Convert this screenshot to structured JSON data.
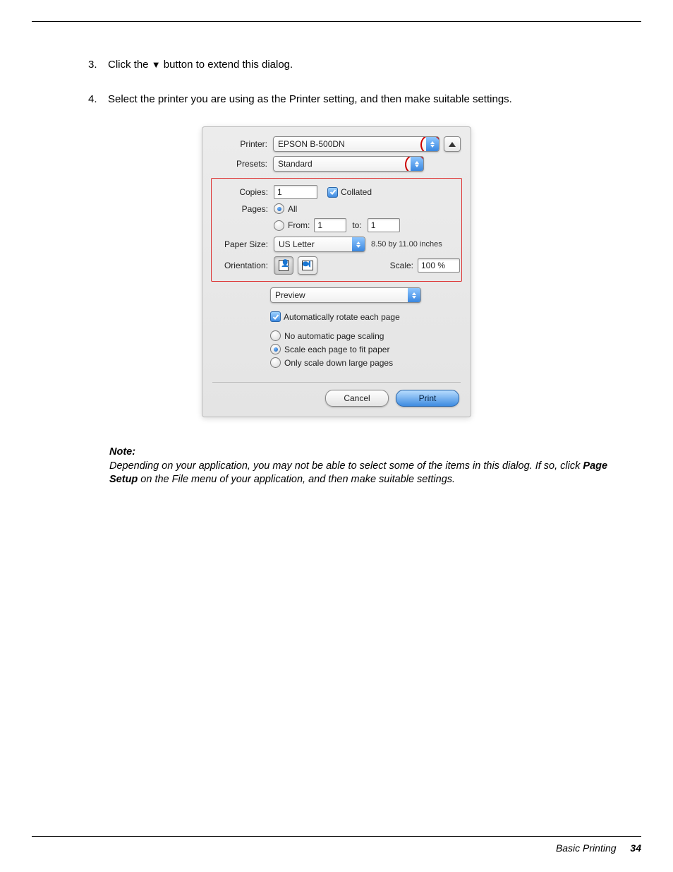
{
  "instructions": {
    "item3_num": "3.",
    "item3_a": "Click the ",
    "item3_b": " button to extend this dialog.",
    "item4_num": "4.",
    "item4": "Select the printer you are using as the Printer setting, and then make suitable settings."
  },
  "dialog": {
    "printer_label": "Printer:",
    "printer_value": "EPSON B-500DN",
    "presets_label": "Presets:",
    "presets_value": "Standard",
    "copies_label": "Copies:",
    "copies_value": "1",
    "collated_label": "Collated",
    "pages_label": "Pages:",
    "pages_all": "All",
    "pages_from": "From:",
    "pages_from_value": "1",
    "pages_to": "to:",
    "pages_to_value": "1",
    "paper_size_label": "Paper Size:",
    "paper_size_value": "US Letter",
    "paper_info": "8.50 by 11.00 inches",
    "orientation_label": "Orientation:",
    "scale_label": "Scale:",
    "scale_value": "100 %",
    "section_value": "Preview",
    "autorotate": "Automatically rotate each page",
    "scaling_none": "No automatic page scaling",
    "scaling_fit": "Scale each page to fit paper",
    "scaling_down": "Only scale down large pages",
    "cancel": "Cancel",
    "print": "Print"
  },
  "note": {
    "head": "Note:",
    "body_a": "Depending on your application, you may not be able to select some of the items in this dialog. If so, click ",
    "body_emph": "Page Setup",
    "body_b": " on the File menu of your application, and then make suitable settings."
  },
  "footer": {
    "section": "Basic Printing",
    "page": "34"
  }
}
